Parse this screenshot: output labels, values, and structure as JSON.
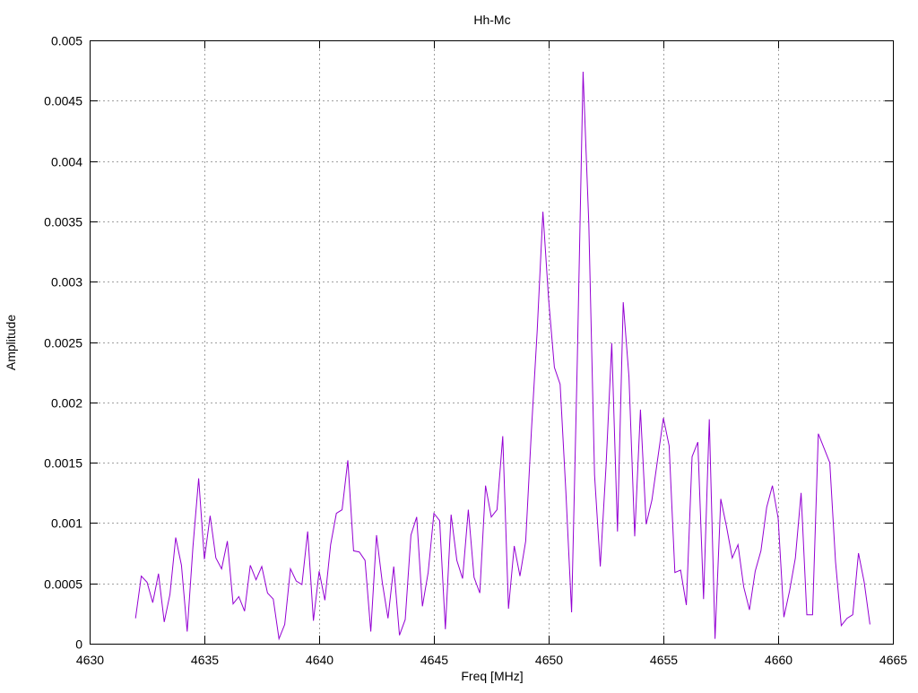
{
  "chart_data": {
    "type": "line",
    "title": "Hh-Mc",
    "xlabel": "Freq [MHz]",
    "ylabel": "Amplitude",
    "xlim": [
      4630,
      4665
    ],
    "ylim": [
      0,
      0.005
    ],
    "grid": true,
    "legend": "none",
    "xticks": [
      "4630",
      "4635",
      "4640",
      "4645",
      "4650",
      "4655",
      "4660",
      "4665"
    ],
    "yticks": [
      "0",
      "0.0005",
      "0.001",
      "0.0015",
      "0.002",
      "0.0025",
      "0.003",
      "0.0035",
      "0.004",
      "0.0045",
      "0.005"
    ],
    "series": [
      {
        "name": "Hh-Mc",
        "color": "#9400d3",
        "x_start": 4632,
        "x_step": 0.25,
        "values": [
          0.00021,
          0.00056,
          0.00051,
          0.00034,
          0.00058,
          0.00018,
          0.00041,
          0.00088,
          0.00065,
          0.0001,
          0.0008,
          0.00137,
          0.0007,
          0.00106,
          0.00071,
          0.00062,
          0.00085,
          0.00033,
          0.00039,
          0.00027,
          0.00065,
          0.00053,
          0.00064,
          0.00042,
          0.00037,
          4e-05,
          0.00016,
          0.00062,
          0.00052,
          0.00049,
          0.00093,
          0.00019,
          0.0006,
          0.00036,
          0.00082,
          0.00108,
          0.00111,
          0.00152,
          0.00077,
          0.00076,
          0.00069,
          0.0001,
          0.0009,
          0.00051,
          0.00021,
          0.00064,
          7e-05,
          0.0002,
          0.0009,
          0.00105,
          0.00031,
          0.00059,
          0.00108,
          0.00102,
          0.00012,
          0.00107,
          0.00069,
          0.00054,
          0.00111,
          0.00055,
          0.00042,
          0.00131,
          0.00105,
          0.00111,
          0.00172,
          0.00029,
          0.00081,
          0.00056,
          0.00085,
          0.00177,
          0.00259,
          0.00358,
          0.00285,
          0.00229,
          0.00215,
          0.00126,
          0.00026,
          0.00236,
          0.00474,
          0.00348,
          0.0014,
          0.00064,
          0.00147,
          0.00249,
          0.00093,
          0.00283,
          0.00221,
          0.00089,
          0.00194,
          0.00099,
          0.00119,
          0.00153,
          0.00187,
          0.00164,
          0.00059,
          0.00061,
          0.00032,
          0.00155,
          0.00167,
          0.00037,
          0.00186,
          4e-05,
          0.0012,
          0.00097,
          0.00071,
          0.00082,
          0.00047,
          0.00028,
          0.0006,
          0.00077,
          0.00113,
          0.00131,
          0.00104,
          0.00022,
          0.00044,
          0.00071,
          0.00125,
          0.00024,
          0.00024,
          0.00174,
          0.00162,
          0.0015,
          0.00068,
          0.00015,
          0.00021,
          0.00024,
          0.00075,
          0.00051,
          0.00016
        ]
      }
    ]
  }
}
